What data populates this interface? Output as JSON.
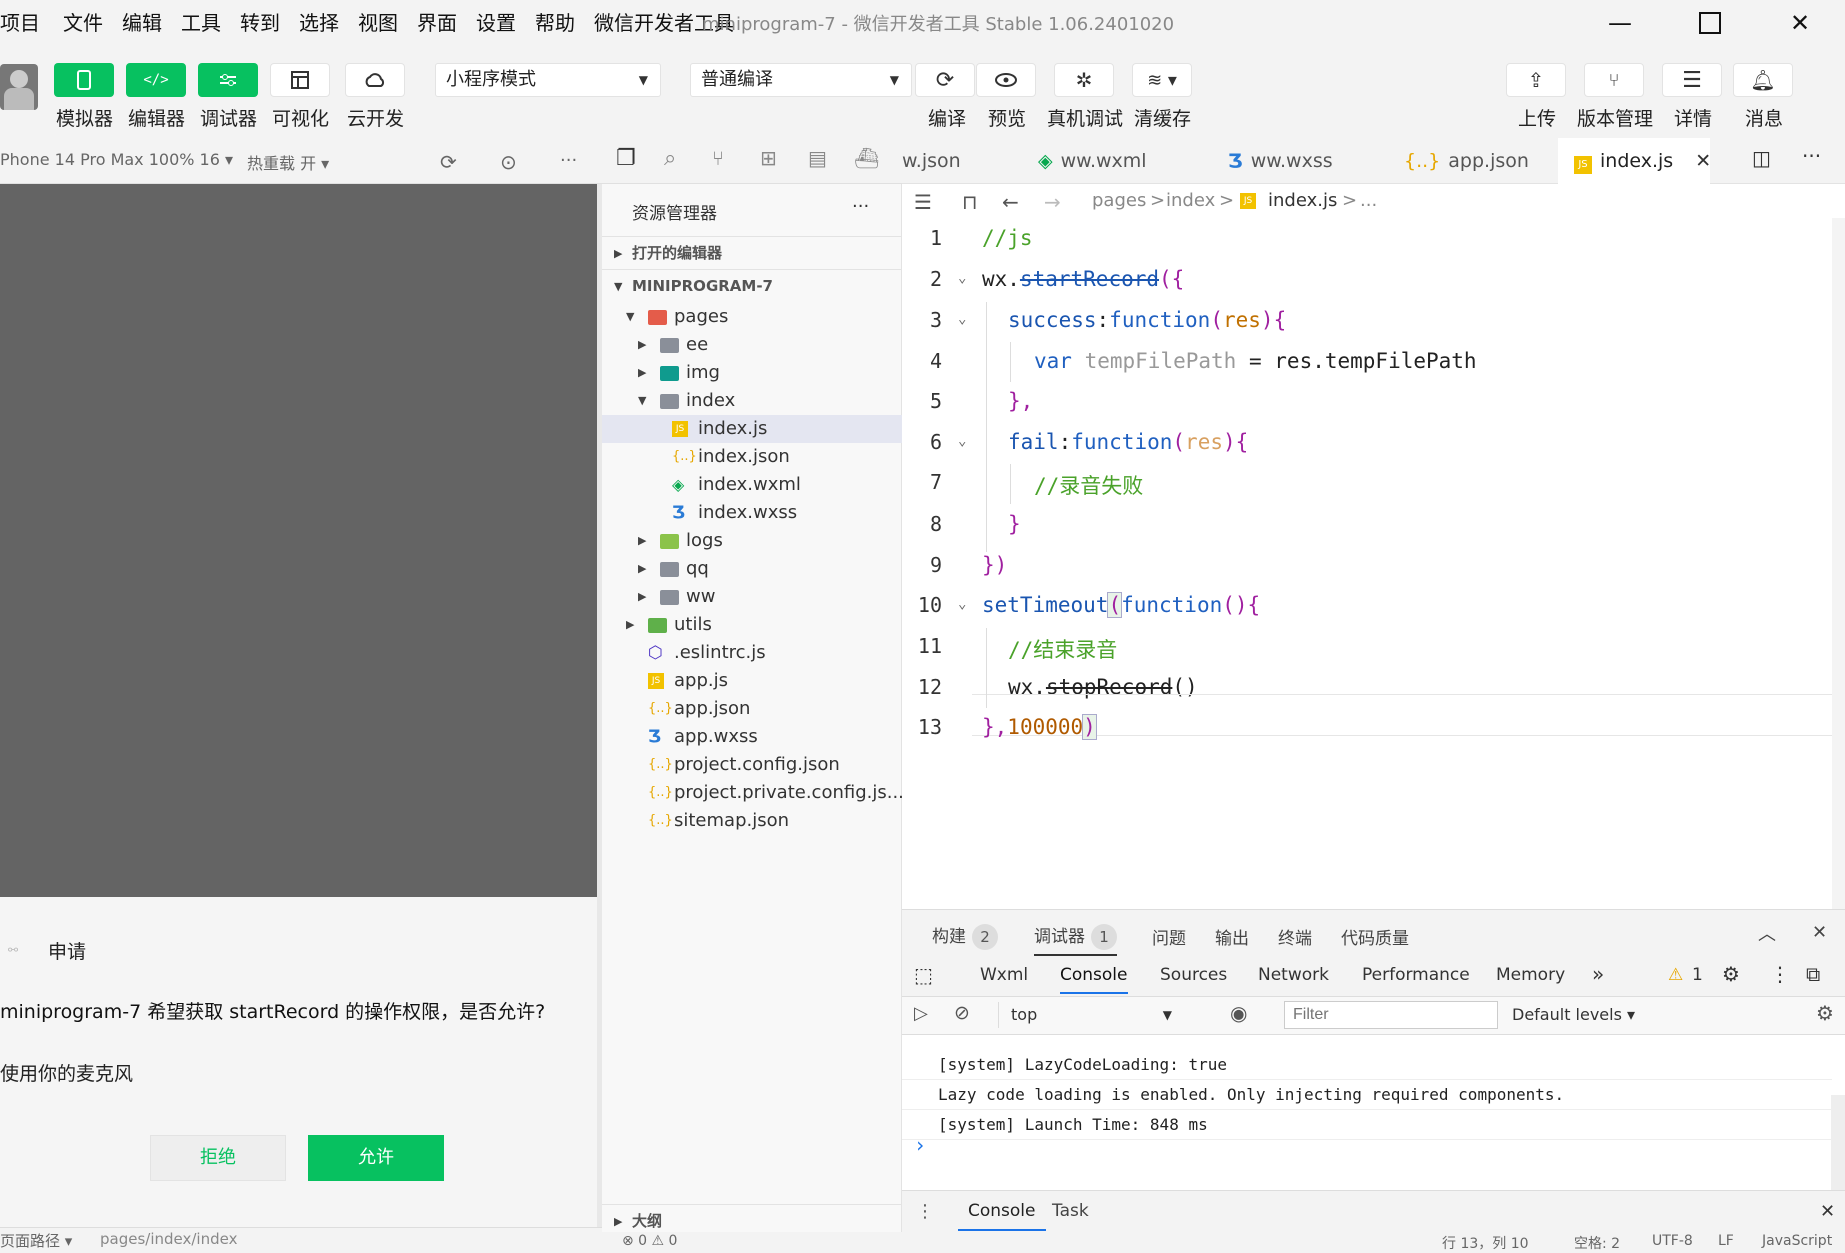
{
  "menubar": {
    "items": [
      "项目",
      "文件",
      "编辑",
      "工具",
      "转到",
      "选择",
      "视图",
      "界面",
      "设置",
      "帮助",
      "微信开发者工具"
    ],
    "title": "miniprogram-7 - 微信开发者工具 Stable 1.06.2401020"
  },
  "toolbar": {
    "simulator": "模拟器",
    "editor": "编辑器",
    "debugger": "调试器",
    "visual": "可视化",
    "cloud": "云开发",
    "mode_select": "小程序模式",
    "compile_select": "普通编译",
    "compile": "编译",
    "preview": "预览",
    "remote_debug": "真机调试",
    "clear_cache": "清缓存",
    "upload": "上传",
    "version": "版本管理",
    "details": "详情",
    "messages": "消息"
  },
  "simulator": {
    "device": "Phone 14 Pro Max 100% 16 ▾",
    "hot_reload": "热重载 开 ▾",
    "dialog": {
      "title": "申请",
      "message": "miniprogram-7 希望获取 startRecord 的操作权限，是否允许?",
      "sub": "使用你的麦克风",
      "reject": "拒绝",
      "allow": "允许"
    },
    "footer_path_label": "页面路径 ▾",
    "footer_path": "pages/index/index"
  },
  "explorer": {
    "title": "资源管理器",
    "more": "···",
    "open_editors": "打开的编辑器",
    "project": "MINIPROGRAM-7",
    "outline": "大纲",
    "tree": [
      {
        "name": "pages",
        "depth": 0,
        "type": "folder-red",
        "open": true
      },
      {
        "name": "ee",
        "depth": 1,
        "type": "folder",
        "open": false
      },
      {
        "name": "img",
        "depth": 1,
        "type": "folder-img",
        "open": false
      },
      {
        "name": "index",
        "depth": 1,
        "type": "folder-open",
        "open": true
      },
      {
        "name": "index.js",
        "depth": 2,
        "type": "js",
        "selected": true
      },
      {
        "name": "index.json",
        "depth": 2,
        "type": "json"
      },
      {
        "name": "index.wxml",
        "depth": 2,
        "type": "wxml"
      },
      {
        "name": "index.wxss",
        "depth": 2,
        "type": "wxss"
      },
      {
        "name": "logs",
        "depth": 1,
        "type": "folder-logs",
        "open": false
      },
      {
        "name": "qq",
        "depth": 1,
        "type": "folder",
        "open": false
      },
      {
        "name": "ww",
        "depth": 1,
        "type": "folder",
        "open": false
      },
      {
        "name": "utils",
        "depth": 0,
        "type": "folder-utils",
        "open": false
      },
      {
        "name": ".eslintrc.js",
        "depth": 0,
        "type": "eslint"
      },
      {
        "name": "app.js",
        "depth": 0,
        "type": "js"
      },
      {
        "name": "app.json",
        "depth": 0,
        "type": "json"
      },
      {
        "name": "app.wxss",
        "depth": 0,
        "type": "wxss"
      },
      {
        "name": "project.config.json",
        "depth": 0,
        "type": "json"
      },
      {
        "name": "project.private.config.js...",
        "depth": 0,
        "type": "json"
      },
      {
        "name": "sitemap.json",
        "depth": 0,
        "type": "json"
      }
    ]
  },
  "tabs": [
    "w.json",
    "ww.wxml",
    "ww.wxss",
    "app.json",
    "index.js"
  ],
  "breadcrumb": [
    "pages",
    ">",
    "index",
    ">",
    "index.js",
    ">",
    "..."
  ],
  "code": {
    "line_numbers": [
      "1",
      "2",
      "3",
      "4",
      "5",
      "6",
      "7",
      "8",
      "9",
      "10",
      "11",
      "12",
      "13"
    ]
  },
  "debugger": {
    "tabs": [
      {
        "label": "构建",
        "badge": "2"
      },
      {
        "label": "调试器",
        "badge": "1"
      },
      {
        "label": "问题"
      },
      {
        "label": "输出"
      },
      {
        "label": "终端"
      },
      {
        "label": "代码质量"
      }
    ],
    "devtools_tabs": [
      "Wxml",
      "Console",
      "Sources",
      "Network",
      "Performance",
      "Memory",
      "»"
    ],
    "warnings": "1",
    "context": "top",
    "filter_placeholder": "Filter",
    "levels": "Default levels ▾",
    "console_lines": [
      "[system] LazyCodeLoading: true",
      "Lazy code loading is enabled. Only injecting required components.",
      "[system] Launch Time: 848 ms"
    ],
    "prompt": "›",
    "drawer_tabs": [
      "Console",
      "Task"
    ]
  },
  "statusbar": {
    "problems": "⊗ 0 ⚠ 0",
    "position": "行 13，列 10",
    "spaces": "空格: 2",
    "encoding": "UTF-8",
    "eol": "LF",
    "language": "JavaScript"
  },
  "colors": {
    "accent_green": "#07c160",
    "keyword_blue": "#2060c0",
    "comment_green": "#4aa22a",
    "brace_purple": "#a020a0"
  }
}
